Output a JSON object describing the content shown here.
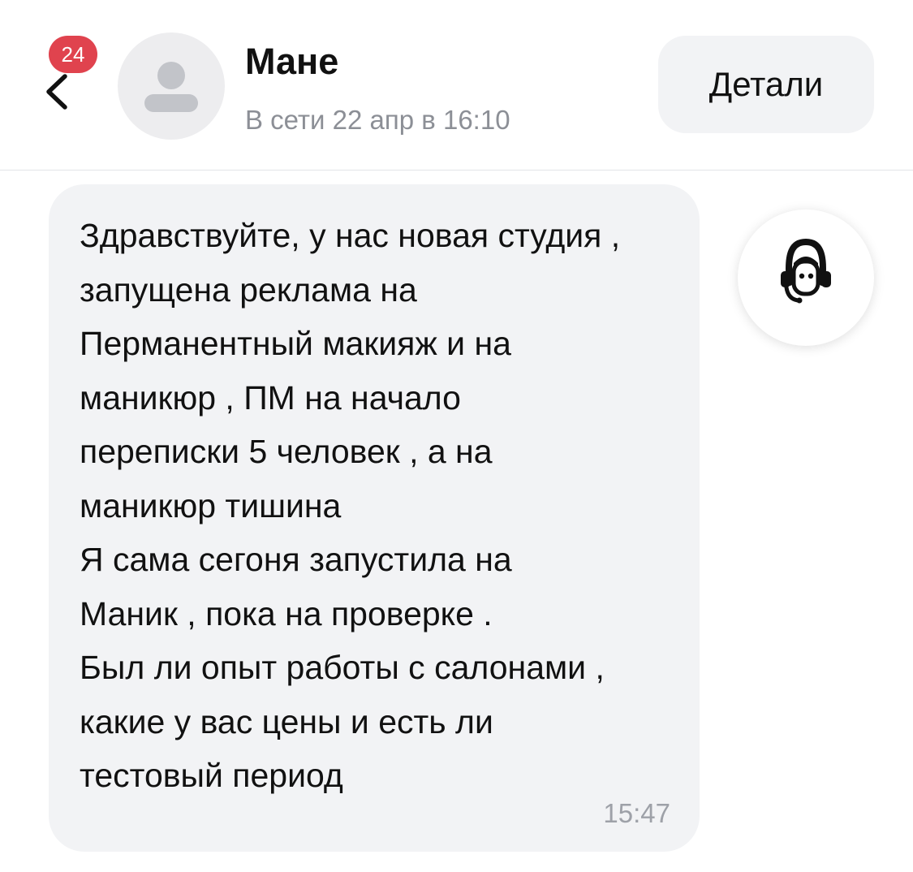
{
  "header": {
    "back_icon": "chevron-left-icon",
    "unread_count": "24",
    "avatar_icon": "user-placeholder-icon",
    "contact_name": "Мане",
    "status": "В сети 22 апр в 16:10",
    "details_label": "Детали"
  },
  "message": {
    "lines": [
      "Здравствуйте, у нас новая студия ,",
      "запущена реклама на",
      "Перманентный макияж и на",
      "маникюр , ПМ на начало",
      "переписки 5 человек , а на",
      "маникюр тишина",
      "Я сама сегоня запустила на",
      "Маник , пока на проверке .",
      "Был ли опыт работы с салонами ,",
      "какие у вас цены и есть ли",
      "тестовый период"
    ],
    "time": "15:47"
  },
  "support": {
    "icon": "support-agent-icon"
  },
  "colors": {
    "badge": "#e0434e",
    "bubble_bg": "#f2f3f5",
    "muted_text": "#8c8f96"
  }
}
